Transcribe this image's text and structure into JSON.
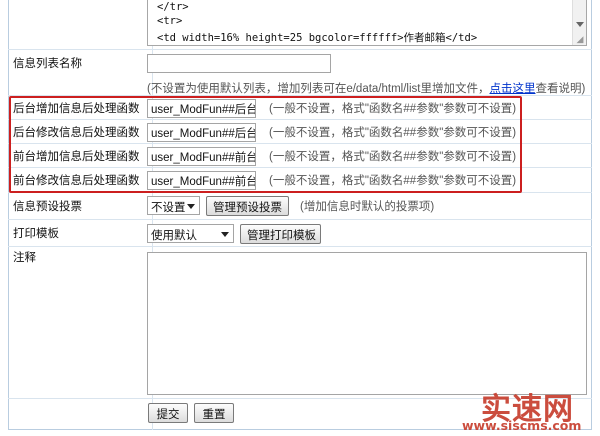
{
  "code_area": {
    "lines": [
      "</tr>",
      "<tr>",
      "  <td width=16% height=25 bgcolor=ffffff>作者邮箱</td>"
    ]
  },
  "list_name": {
    "label": "信息列表名称",
    "value": "",
    "hint_before": "(不设置为使用默认列表，增加列表可在e/data/html/list里增加文件，",
    "hint_link": "点击这里",
    "hint_after": "查看说明)"
  },
  "functions": [
    {
      "label": "后台增加信息后处理函数",
      "value": "user_ModFun##后台增",
      "note": "(一般不设置，格式\"函数名##参数\"参数可不设置)"
    },
    {
      "label": "后台修改信息后处理函数",
      "value": "user_ModFun##后台修",
      "note": "(一般不设置，格式\"函数名##参数\"参数可不设置)"
    },
    {
      "label": "前台增加信息后处理函数",
      "value": "user_ModFun##前台增",
      "note": "(一般不设置，格式\"函数名##参数\"参数可不设置)"
    },
    {
      "label": "前台修改信息后处理函数",
      "value": "user_ModFun##前台修",
      "note": "(一般不设置，格式\"函数名##参数\"参数可不设置)"
    }
  ],
  "vote": {
    "label": "信息预设投票",
    "selected": "不设置",
    "manage_button": "管理预设投票",
    "note": "(增加信息时默认的投票项)"
  },
  "print_template": {
    "label": "打印模板",
    "selected": "使用默认",
    "manage_button": "管理打印模板"
  },
  "remark": {
    "label": "注释",
    "value": ""
  },
  "actions": {
    "submit": "提交",
    "reset": "重置"
  },
  "watermark": {
    "name": "实速网",
    "url": "www.siscms.com"
  },
  "colors": {
    "highlight_border": "#cc1f1f",
    "link": "#0033cc",
    "watermark": "#c63a2a"
  }
}
